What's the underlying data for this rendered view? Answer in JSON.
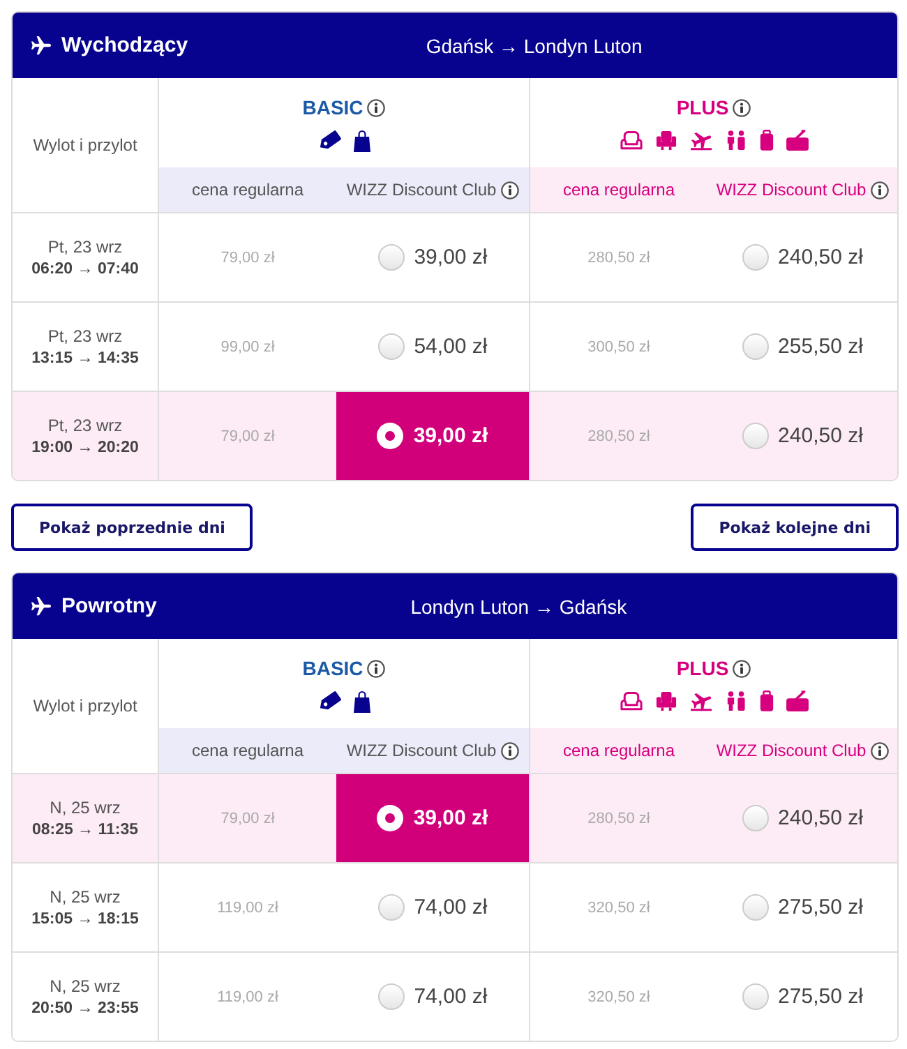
{
  "outbound": {
    "title": "Wychodzący",
    "route": "Gdańsk → Londyn Luton",
    "time_column": "Wylot i przylot",
    "fares": [
      {
        "name": "BASIC",
        "kind": "basic",
        "info": true,
        "columns": [
          {
            "label": "cena regularna",
            "info": false
          },
          {
            "label": "WIZZ Discount Club",
            "info": true
          }
        ]
      },
      {
        "name": "PLUS",
        "kind": "plus",
        "info": true,
        "columns": [
          {
            "label": "cena regularna",
            "info": false
          },
          {
            "label": "WIZZ Discount Club",
            "info": true
          }
        ]
      }
    ],
    "flights": [
      {
        "date": "Pt, 23 wrz",
        "times": "06:20 → 07:40",
        "selected": false,
        "prices": [
          {
            "regular": "79,00 zł",
            "discount": "39,00 zł",
            "selected": false
          },
          {
            "regular": "280,50 zł",
            "discount": "240,50 zł",
            "selected": false
          }
        ]
      },
      {
        "date": "Pt, 23 wrz",
        "times": "13:15 → 14:35",
        "selected": false,
        "prices": [
          {
            "regular": "99,00 zł",
            "discount": "54,00 zł",
            "selected": false
          },
          {
            "regular": "300,50 zł",
            "discount": "255,50 zł",
            "selected": false
          }
        ]
      },
      {
        "date": "Pt, 23 wrz",
        "times": "19:00 → 20:20",
        "selected": true,
        "prices": [
          {
            "regular": "79,00 zł",
            "discount": "39,00 zł",
            "selected": true
          },
          {
            "regular": "280,50 zł",
            "discount": "240,50 zł",
            "selected": false
          }
        ]
      }
    ]
  },
  "day_navigation": [
    {
      "label": "Pokaż poprzednie dni"
    },
    {
      "label": "Pokaż kolejne dni"
    }
  ],
  "return": {
    "title": "Powrotny",
    "route": "Londyn Luton → Gdańsk",
    "time_column": "Wylot i przylot",
    "fares": [
      {
        "name": "BASIC",
        "kind": "basic",
        "info": true,
        "columns": [
          {
            "label": "cena regularna",
            "info": false
          },
          {
            "label": "WIZZ Discount Club",
            "info": true
          }
        ]
      },
      {
        "name": "PLUS",
        "kind": "plus",
        "info": true,
        "columns": [
          {
            "label": "cena regularna",
            "info": false
          },
          {
            "label": "WIZZ Discount Club",
            "info": true
          }
        ]
      }
    ],
    "flights": [
      {
        "date": "N, 25 wrz",
        "times": "08:25 → 11:35",
        "selected": true,
        "prices": [
          {
            "regular": "79,00 zł",
            "discount": "39,00 zł",
            "selected": true
          },
          {
            "regular": "280,50 zł",
            "discount": "240,50 zł",
            "selected": false
          }
        ]
      },
      {
        "date": "N, 25 wrz",
        "times": "15:05 → 18:15",
        "selected": false,
        "prices": [
          {
            "regular": "119,00 zł",
            "discount": "74,00 zł",
            "selected": false
          },
          {
            "regular": "320,50 zł",
            "discount": "275,50 zł",
            "selected": false
          }
        ]
      },
      {
        "date": "N, 25 wrz",
        "times": "20:50 → 23:55",
        "selected": false,
        "prices": [
          {
            "regular": "119,00 zł",
            "discount": "74,00 zł",
            "selected": false
          },
          {
            "regular": "320,50 zł",
            "discount": "275,50 zł",
            "selected": false
          }
        ]
      }
    ]
  }
}
